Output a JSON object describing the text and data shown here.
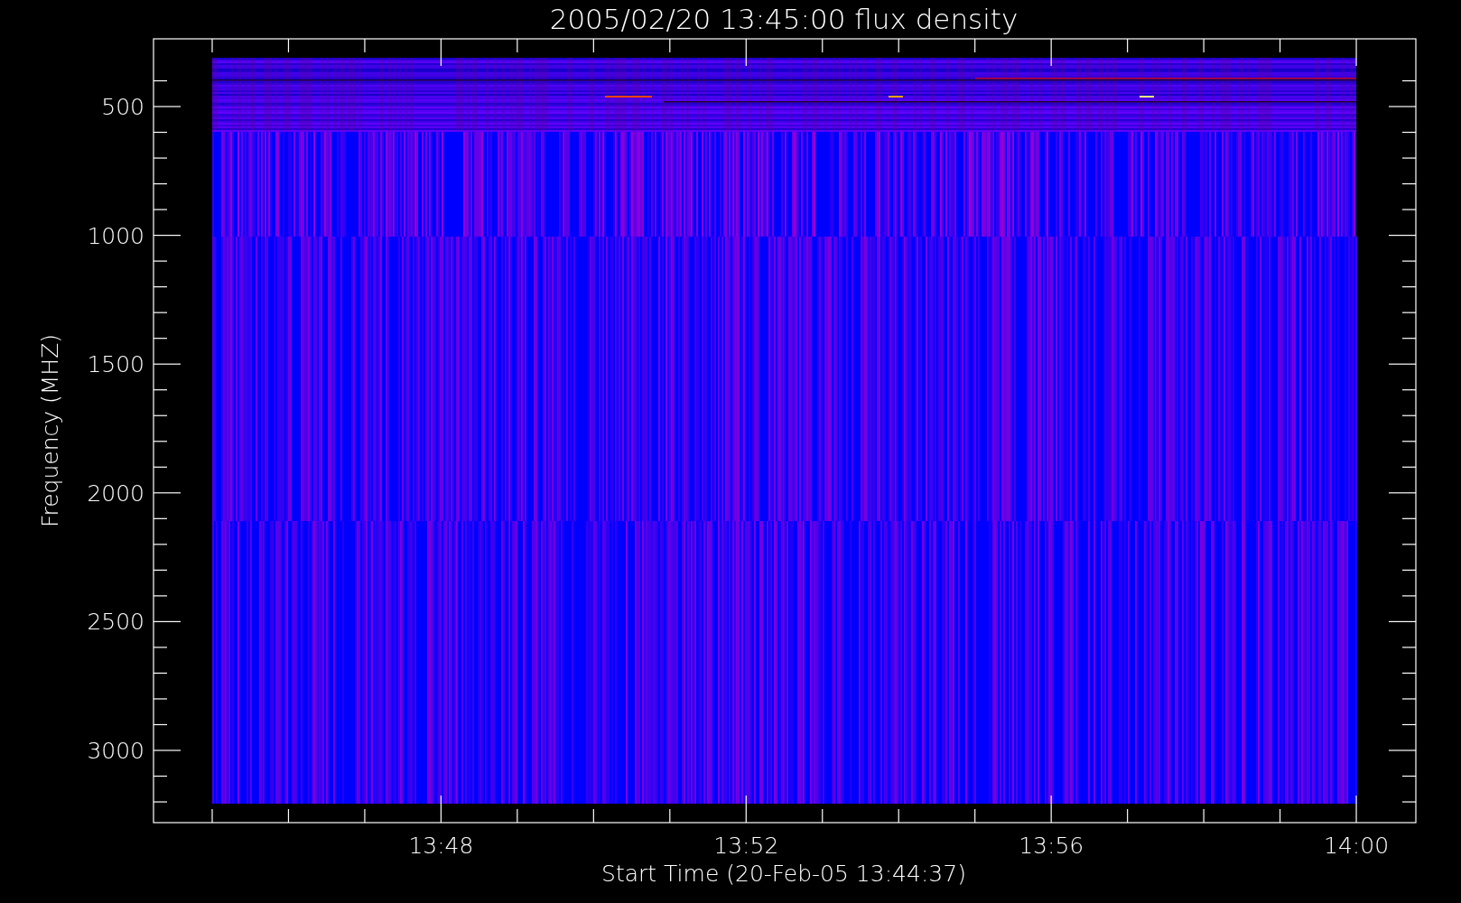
{
  "title": "2005/02/20 13:45:00 flux density",
  "y_axis": {
    "label": "Frequency (MHZ)",
    "ticks": [
      "500",
      "1000",
      "1500",
      "2000",
      "2500",
      "3000"
    ]
  },
  "x_axis": {
    "label": "Start Time (20-Feb-05 13:44:37)",
    "ticks": [
      "13:48",
      "13:52",
      "13:56",
      "14:00"
    ]
  }
}
